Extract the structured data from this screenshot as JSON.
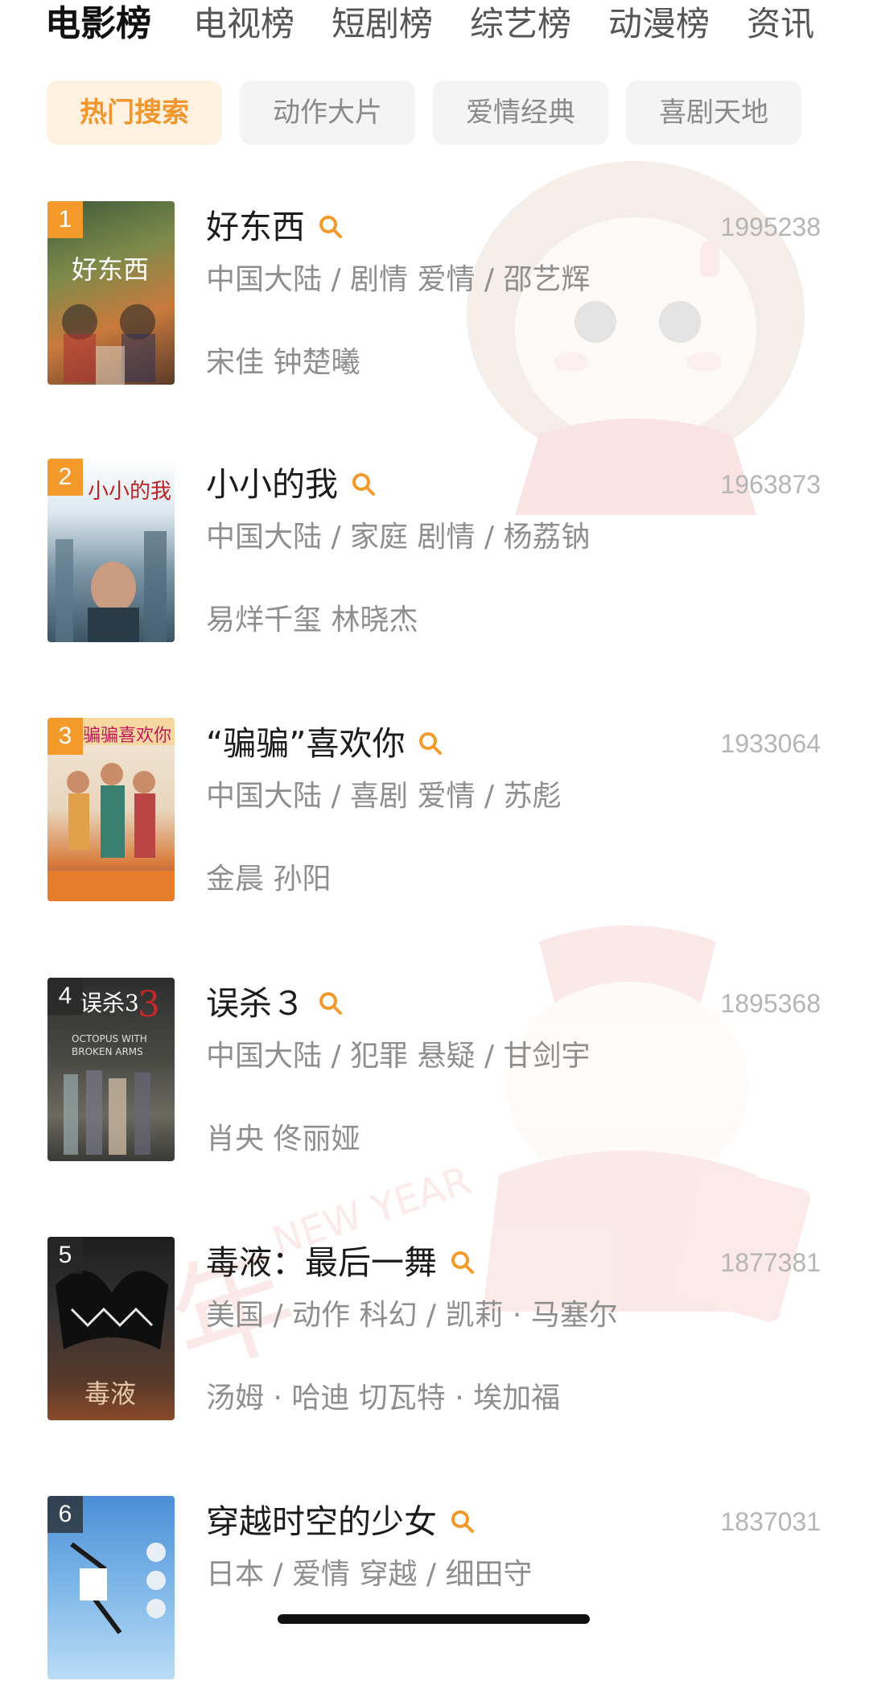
{
  "top_tabs": [
    "电影榜",
    "电视榜",
    "短剧榜",
    "综艺榜",
    "动漫榜",
    "资讯"
  ],
  "chips": [
    "热门搜索",
    "动作大片",
    "爱情经典",
    "喜剧天地"
  ],
  "movies": [
    {
      "rank": "1",
      "title": "好东西",
      "score": "1995238",
      "meta": "中国大陆 / 剧情 爱情 / 邵艺辉",
      "cast": "宋佳 钟楚曦",
      "poster_text": "好东西"
    },
    {
      "rank": "2",
      "title": "小小的我",
      "score": "1963873",
      "meta": "中国大陆 / 家庭 剧情 / 杨荔钠",
      "cast": "易烊千玺 林晓杰",
      "poster_text": "小小的我"
    },
    {
      "rank": "3",
      "title": "“骗骗”喜欢你",
      "score": "1933064",
      "meta": "中国大陆 / 喜剧 爱情 / 苏彪",
      "cast": "金晨 孙阳",
      "poster_text": "骗骗喜欢你"
    },
    {
      "rank": "4",
      "title": "误杀３",
      "score": "1895368",
      "meta": "中国大陆 / 犯罪 悬疑 / 甘剑宇",
      "cast": "肖央 佟丽娅",
      "poster_text": "误杀3"
    },
    {
      "rank": "5",
      "title": "毒液：最后一舞",
      "score": "1877381",
      "meta": "美国 / 动作 科幻 / 凯莉 · 马塞尔",
      "cast": "汤姆 · 哈迪   切瓦特 · 埃加福",
      "poster_text": "毒液"
    },
    {
      "rank": "6",
      "title": "穿越时空的少女",
      "score": "1837031",
      "meta": "日本 / 爱情 穿越 / 细田守",
      "cast": "",
      "poster_text": ""
    }
  ],
  "colors": {
    "accent": "#f39a2a",
    "chip_active_bg": "#fff1e0",
    "text_secondary": "#8e8e8e",
    "score": "#b5b5b5"
  }
}
